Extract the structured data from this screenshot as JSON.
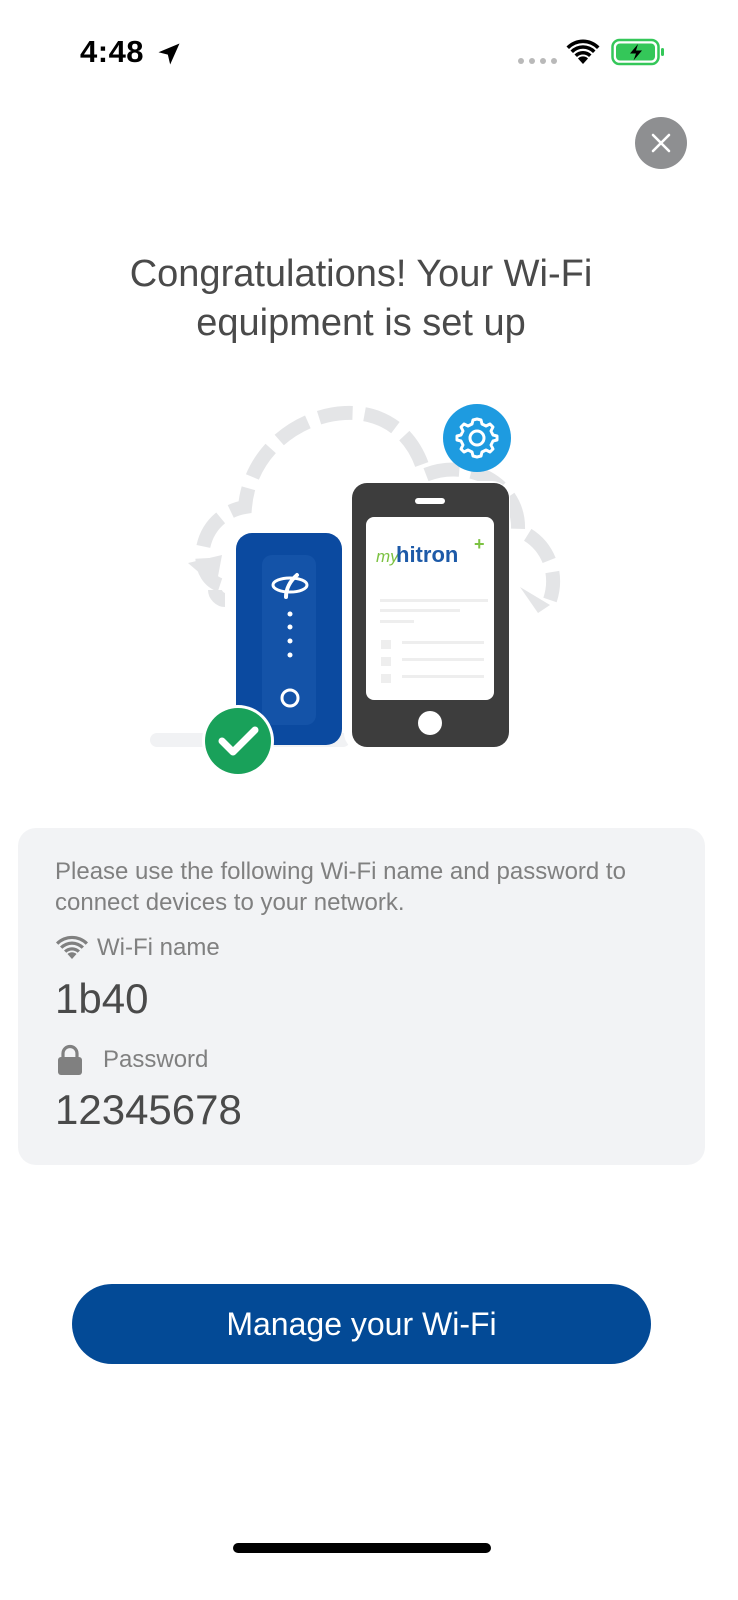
{
  "status_bar": {
    "time": "4:48",
    "icons": [
      "location-arrow-icon",
      "cellular-signal-icon",
      "wifi-icon",
      "battery-charging-icon"
    ],
    "battery_color": "#34c759"
  },
  "close_icon": "close-icon",
  "title": "Congratulations! Your Wi-Fi equipment is set up",
  "illustration": {
    "phone_app_logo": "myhitron+",
    "icons": [
      "cloud-sync-icon",
      "gear-icon",
      "router-icon",
      "phone-icon",
      "checkmark-icon"
    ]
  },
  "info_card": {
    "description": "Please use the following Wi-Fi name and password to connect devices to your network.",
    "wifi_name_label": "Wi-Fi name",
    "wifi_name_value": "1b40",
    "password_label": "Password",
    "password_value": "12345678"
  },
  "manage_button_label": "Manage your Wi-Fi",
  "colors": {
    "primary_blue": "#034a96",
    "gear_blue": "#1e9be0",
    "check_green": "#19a15a",
    "card_bg": "#f2f3f5",
    "logo_green": "#7cc242"
  }
}
